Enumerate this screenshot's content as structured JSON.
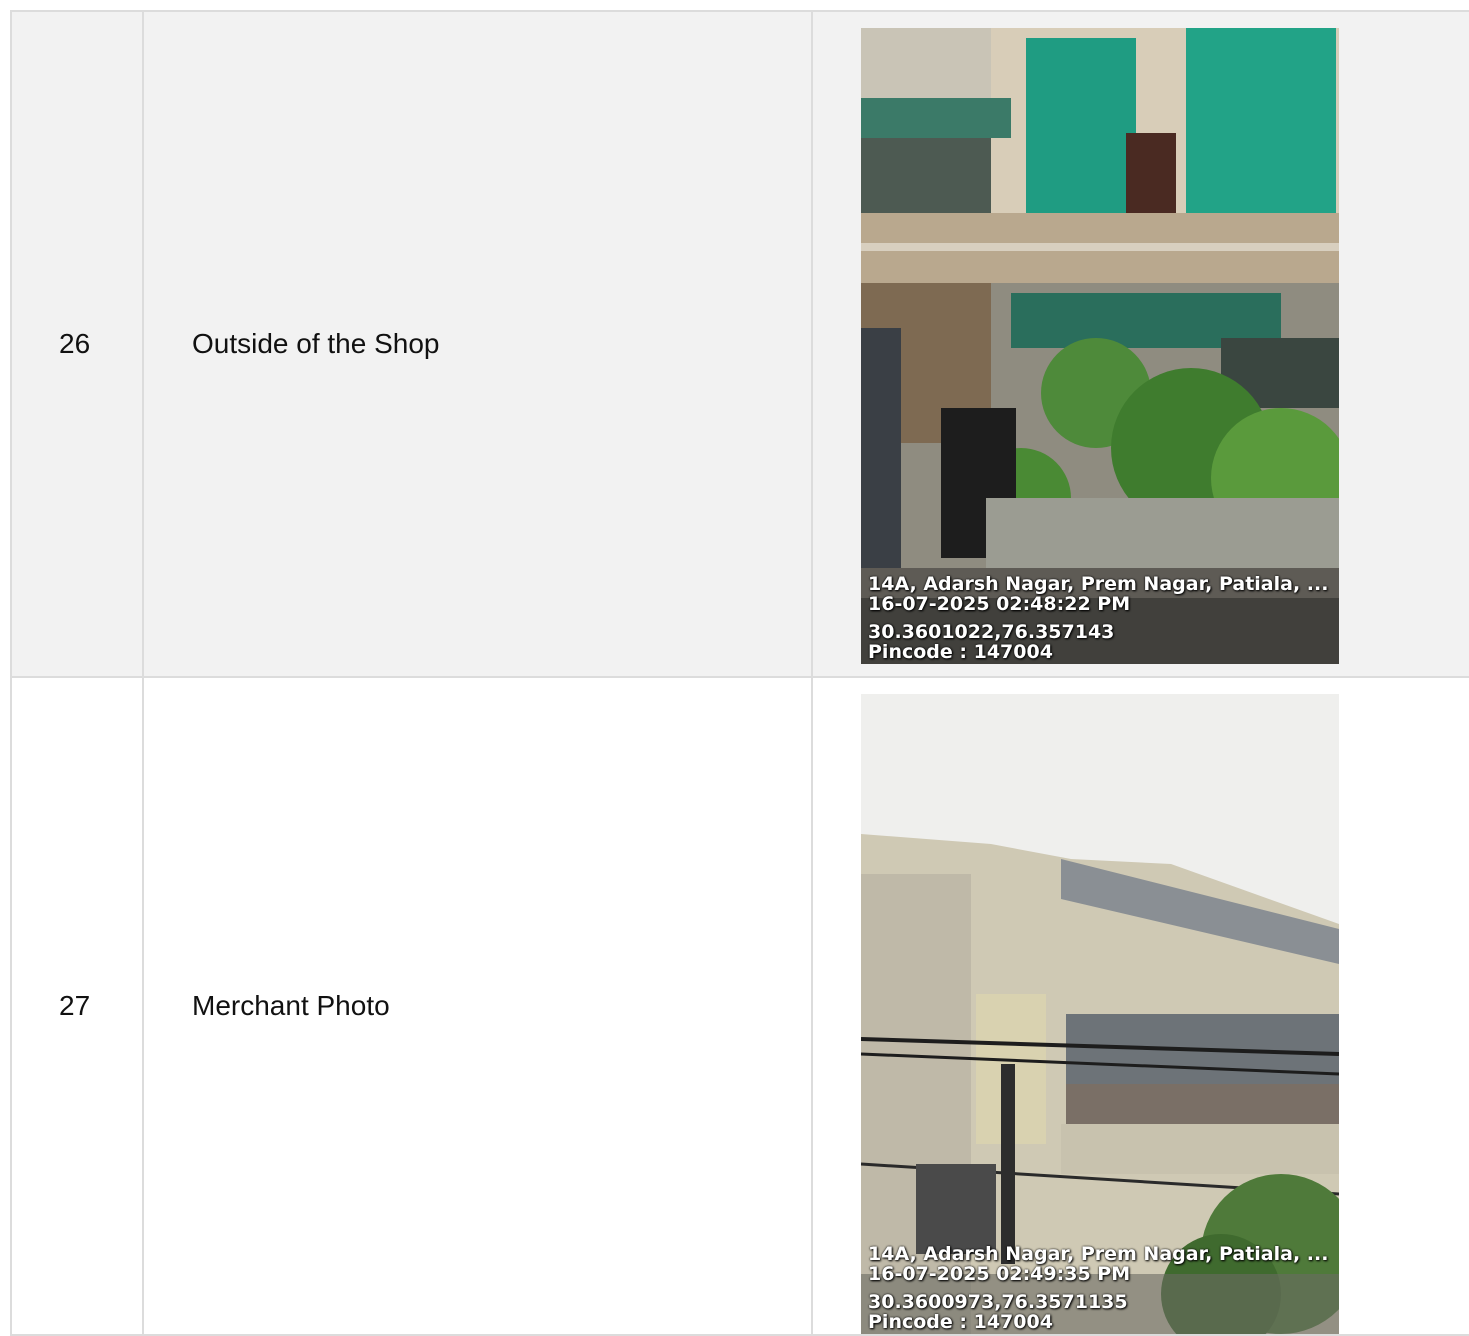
{
  "rows": [
    {
      "number": "26",
      "label": "Outside of the Shop",
      "photo": {
        "address": "14A, Adarsh Nagar, Prem Nagar, Patiala, ...",
        "datetime": "16-07-2025 02:48:22 PM",
        "coords": "30.3601022,76.357143",
        "pincode": "Pincode : 147004"
      }
    },
    {
      "number": "27",
      "label": "Merchant Photo",
      "photo": {
        "address": "14A, Adarsh Nagar, Prem Nagar, Patiala, ...",
        "datetime": "16-07-2025 02:49:35 PM",
        "coords": "30.3600973,76.3571135",
        "pincode": "Pincode : 147004"
      }
    }
  ],
  "colors": {
    "row_alt_bg": "#f2f2f2",
    "border": "#dcdcdc",
    "text": "#111111"
  }
}
